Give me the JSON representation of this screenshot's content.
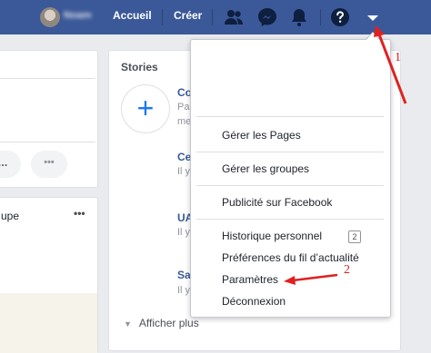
{
  "header": {
    "username": "Noam",
    "nav": [
      "Accueil",
      "Créer"
    ],
    "icons": [
      "friends-icon",
      "messenger-icon",
      "notifications-icon",
      "help-icon",
      "account-menu-icon"
    ]
  },
  "left": {
    "pill_more": "...",
    "pill_dots": "•••",
    "group_text": "upe",
    "card_more": "•••"
  },
  "stories": {
    "title": "Stories",
    "items": [
      {
        "name": "Co",
        "sub": "Pa",
        "sub2": "me"
      },
      {
        "name": "Ce",
        "sub": "Il y"
      },
      {
        "name": "UA",
        "sub": "Il y"
      },
      {
        "name": "Sa",
        "sub": "Il y"
      }
    ],
    "show_more": "Afficher plus"
  },
  "menu": {
    "groups": [
      [
        "Gérer les Pages"
      ],
      [
        "Gérer les groupes"
      ],
      [
        "Publicité sur Facebook"
      ],
      [
        "Historique personnel",
        "Préférences du fil d’actualité",
        "Paramètres",
        "Déconnexion"
      ]
    ],
    "history_count": "2"
  },
  "annotations": {
    "label_1": "1",
    "label_2": "2",
    "color": "#e02020"
  },
  "colors": {
    "topbar": "#3b5998",
    "background": "#e9ebee",
    "link": "#385898"
  }
}
